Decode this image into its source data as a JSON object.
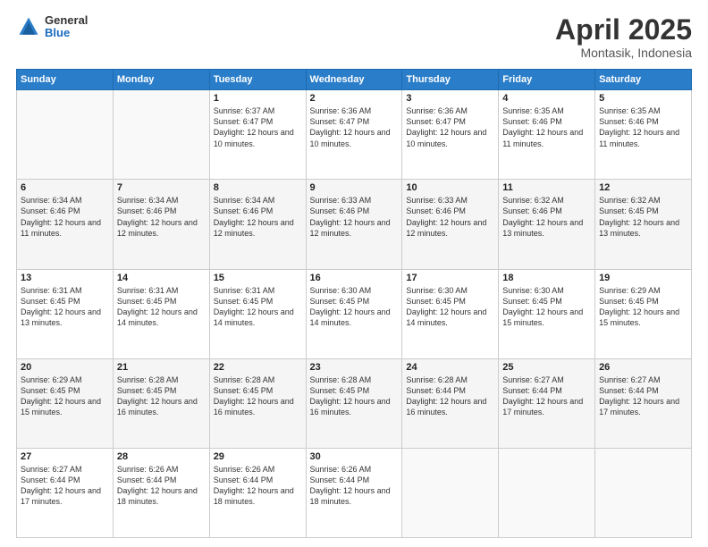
{
  "header": {
    "logo_general": "General",
    "logo_blue": "Blue",
    "title": "April 2025",
    "location": "Montasik, Indonesia"
  },
  "weekdays": [
    "Sunday",
    "Monday",
    "Tuesday",
    "Wednesday",
    "Thursday",
    "Friday",
    "Saturday"
  ],
  "weeks": [
    [
      {
        "day": "",
        "empty": true
      },
      {
        "day": "",
        "empty": true
      },
      {
        "day": "1",
        "sunrise": "Sunrise: 6:37 AM",
        "sunset": "Sunset: 6:47 PM",
        "daylight": "Daylight: 12 hours and 10 minutes."
      },
      {
        "day": "2",
        "sunrise": "Sunrise: 6:36 AM",
        "sunset": "Sunset: 6:47 PM",
        "daylight": "Daylight: 12 hours and 10 minutes."
      },
      {
        "day": "3",
        "sunrise": "Sunrise: 6:36 AM",
        "sunset": "Sunset: 6:47 PM",
        "daylight": "Daylight: 12 hours and 10 minutes."
      },
      {
        "day": "4",
        "sunrise": "Sunrise: 6:35 AM",
        "sunset": "Sunset: 6:46 PM",
        "daylight": "Daylight: 12 hours and 11 minutes."
      },
      {
        "day": "5",
        "sunrise": "Sunrise: 6:35 AM",
        "sunset": "Sunset: 6:46 PM",
        "daylight": "Daylight: 12 hours and 11 minutes."
      }
    ],
    [
      {
        "day": "6",
        "sunrise": "Sunrise: 6:34 AM",
        "sunset": "Sunset: 6:46 PM",
        "daylight": "Daylight: 12 hours and 11 minutes."
      },
      {
        "day": "7",
        "sunrise": "Sunrise: 6:34 AM",
        "sunset": "Sunset: 6:46 PM",
        "daylight": "Daylight: 12 hours and 12 minutes."
      },
      {
        "day": "8",
        "sunrise": "Sunrise: 6:34 AM",
        "sunset": "Sunset: 6:46 PM",
        "daylight": "Daylight: 12 hours and 12 minutes."
      },
      {
        "day": "9",
        "sunrise": "Sunrise: 6:33 AM",
        "sunset": "Sunset: 6:46 PM",
        "daylight": "Daylight: 12 hours and 12 minutes."
      },
      {
        "day": "10",
        "sunrise": "Sunrise: 6:33 AM",
        "sunset": "Sunset: 6:46 PM",
        "daylight": "Daylight: 12 hours and 12 minutes."
      },
      {
        "day": "11",
        "sunrise": "Sunrise: 6:32 AM",
        "sunset": "Sunset: 6:46 PM",
        "daylight": "Daylight: 12 hours and 13 minutes."
      },
      {
        "day": "12",
        "sunrise": "Sunrise: 6:32 AM",
        "sunset": "Sunset: 6:45 PM",
        "daylight": "Daylight: 12 hours and 13 minutes."
      }
    ],
    [
      {
        "day": "13",
        "sunrise": "Sunrise: 6:31 AM",
        "sunset": "Sunset: 6:45 PM",
        "daylight": "Daylight: 12 hours and 13 minutes."
      },
      {
        "day": "14",
        "sunrise": "Sunrise: 6:31 AM",
        "sunset": "Sunset: 6:45 PM",
        "daylight": "Daylight: 12 hours and 14 minutes."
      },
      {
        "day": "15",
        "sunrise": "Sunrise: 6:31 AM",
        "sunset": "Sunset: 6:45 PM",
        "daylight": "Daylight: 12 hours and 14 minutes."
      },
      {
        "day": "16",
        "sunrise": "Sunrise: 6:30 AM",
        "sunset": "Sunset: 6:45 PM",
        "daylight": "Daylight: 12 hours and 14 minutes."
      },
      {
        "day": "17",
        "sunrise": "Sunrise: 6:30 AM",
        "sunset": "Sunset: 6:45 PM",
        "daylight": "Daylight: 12 hours and 14 minutes."
      },
      {
        "day": "18",
        "sunrise": "Sunrise: 6:30 AM",
        "sunset": "Sunset: 6:45 PM",
        "daylight": "Daylight: 12 hours and 15 minutes."
      },
      {
        "day": "19",
        "sunrise": "Sunrise: 6:29 AM",
        "sunset": "Sunset: 6:45 PM",
        "daylight": "Daylight: 12 hours and 15 minutes."
      }
    ],
    [
      {
        "day": "20",
        "sunrise": "Sunrise: 6:29 AM",
        "sunset": "Sunset: 6:45 PM",
        "daylight": "Daylight: 12 hours and 15 minutes."
      },
      {
        "day": "21",
        "sunrise": "Sunrise: 6:28 AM",
        "sunset": "Sunset: 6:45 PM",
        "daylight": "Daylight: 12 hours and 16 minutes."
      },
      {
        "day": "22",
        "sunrise": "Sunrise: 6:28 AM",
        "sunset": "Sunset: 6:45 PM",
        "daylight": "Daylight: 12 hours and 16 minutes."
      },
      {
        "day": "23",
        "sunrise": "Sunrise: 6:28 AM",
        "sunset": "Sunset: 6:45 PM",
        "daylight": "Daylight: 12 hours and 16 minutes."
      },
      {
        "day": "24",
        "sunrise": "Sunrise: 6:28 AM",
        "sunset": "Sunset: 6:44 PM",
        "daylight": "Daylight: 12 hours and 16 minutes."
      },
      {
        "day": "25",
        "sunrise": "Sunrise: 6:27 AM",
        "sunset": "Sunset: 6:44 PM",
        "daylight": "Daylight: 12 hours and 17 minutes."
      },
      {
        "day": "26",
        "sunrise": "Sunrise: 6:27 AM",
        "sunset": "Sunset: 6:44 PM",
        "daylight": "Daylight: 12 hours and 17 minutes."
      }
    ],
    [
      {
        "day": "27",
        "sunrise": "Sunrise: 6:27 AM",
        "sunset": "Sunset: 6:44 PM",
        "daylight": "Daylight: 12 hours and 17 minutes."
      },
      {
        "day": "28",
        "sunrise": "Sunrise: 6:26 AM",
        "sunset": "Sunset: 6:44 PM",
        "daylight": "Daylight: 12 hours and 18 minutes."
      },
      {
        "day": "29",
        "sunrise": "Sunrise: 6:26 AM",
        "sunset": "Sunset: 6:44 PM",
        "daylight": "Daylight: 12 hours and 18 minutes."
      },
      {
        "day": "30",
        "sunrise": "Sunrise: 6:26 AM",
        "sunset": "Sunset: 6:44 PM",
        "daylight": "Daylight: 12 hours and 18 minutes."
      },
      {
        "day": "",
        "empty": true
      },
      {
        "day": "",
        "empty": true
      },
      {
        "day": "",
        "empty": true
      }
    ]
  ]
}
